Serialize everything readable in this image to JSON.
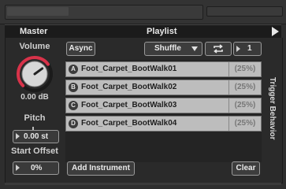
{
  "header": {
    "left_title": "Master",
    "center_title": "Playlist"
  },
  "master": {
    "volume_label": "Volume",
    "volume_value": "0.00 dB",
    "volume_level": 0.7,
    "pitch_label": "Pitch",
    "pitch_value": "0.00 st",
    "start_offset_label": "Start Offset",
    "start_offset_value": "0%"
  },
  "playlist": {
    "async_label": "Async",
    "mode_selected": "Shuffle",
    "loop_icon": "repeat-icon",
    "count_value": "1",
    "items": [
      {
        "letter": "A",
        "name": "Foot_Carpet_BootWalk01",
        "weight": "(25%)"
      },
      {
        "letter": "B",
        "name": "Foot_Carpet_BootWalk02",
        "weight": "(25%)"
      },
      {
        "letter": "C",
        "name": "Foot_Carpet_BootWalk03",
        "weight": "(25%)"
      },
      {
        "letter": "D",
        "name": "Foot_Carpet_BootWalk04",
        "weight": "(25%)"
      }
    ],
    "add_instrument_label": "Add Instrument",
    "clear_label": "Clear"
  },
  "side_tab": {
    "label": "Trigger Behavior"
  },
  "colors": {
    "knob_accent": "#d8334a",
    "row_bg": "#bdbdbd",
    "panel_bg": "#2a2a2a"
  }
}
